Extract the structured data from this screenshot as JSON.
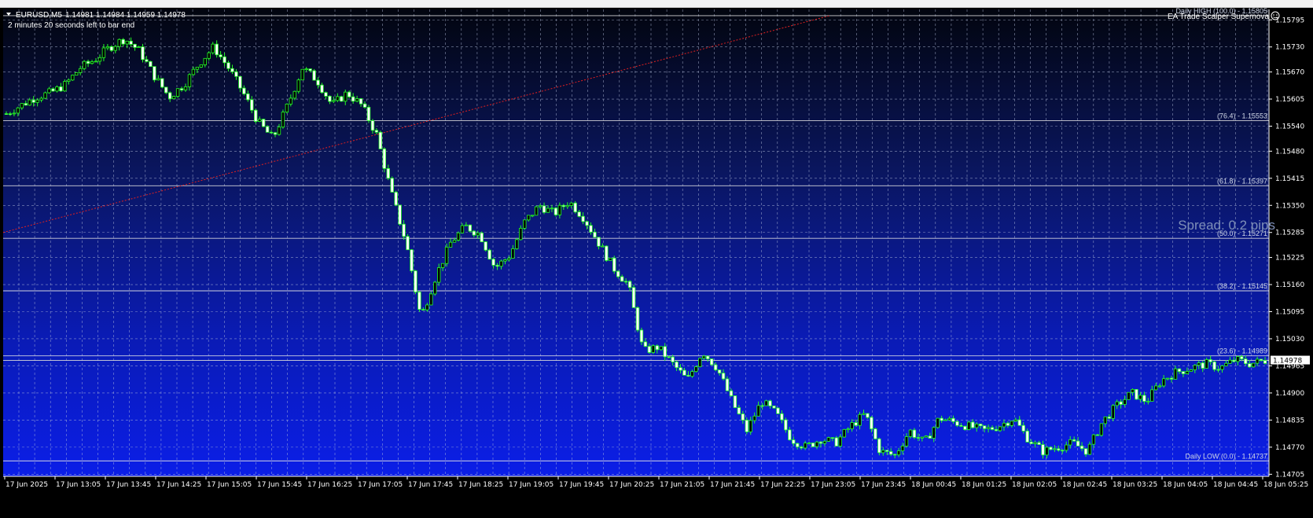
{
  "header": {
    "symbol": "EURUSD,M5",
    "ohlc": "1.14981 1.14984 1.14959 1.14978",
    "timer": "2 minutes 20 seconds left to bar end",
    "ea_name": "EA Trade Scalper Supernova"
  },
  "spread_text": "Spread: 0.2 pips",
  "colors": {
    "background_top": "#02050f",
    "background_bottom": "#0b1ee8",
    "candle": "#24ff24",
    "grid": "#b4bedc",
    "trendline": "#e02020",
    "fib_line": "#e6e6e6",
    "fib_text": "#cfd6e6",
    "price_tag_bg": "#ffffff",
    "price_tag_text": "#000000"
  },
  "fib_levels": [
    {
      "price": 1.15805,
      "label": "Daily HIGH (100.0) - 1.15805"
    },
    {
      "price": 1.15553,
      "label": "(76.4) - 1.15553"
    },
    {
      "price": 1.15397,
      "label": "(61.8) - 1.15397"
    },
    {
      "price": 1.15271,
      "label": "(50.0) - 1.15271"
    },
    {
      "price": 1.15145,
      "label": "(38.2) - 1.15145"
    },
    {
      "price": 1.14989,
      "label": "(23.6) - 1.14989"
    },
    {
      "price": 1.14737,
      "label": "Daily LOW (0.0) - 1.14737"
    }
  ],
  "current_price": "1.14978",
  "chart_data": {
    "type": "candlestick",
    "symbol": "EURUSD",
    "timeframe": "M5",
    "ylim": [
      1.147,
      1.1582
    ],
    "y_ticks": [
      "1.15795",
      "1.15730",
      "1.15670",
      "1.15605",
      "1.15540",
      "1.15480",
      "1.15415",
      "1.15350",
      "1.15285",
      "1.15225",
      "1.15160",
      "1.15095",
      "1.15030",
      "1.14965",
      "1.14900",
      "1.14835",
      "1.14770",
      "1.14705"
    ],
    "x_ticks": [
      "17 Jun 2025",
      "17 Jun 13:05",
      "17 Jun 13:45",
      "17 Jun 14:25",
      "17 Jun 15:05",
      "17 Jun 15:45",
      "17 Jun 16:25",
      "17 Jun 17:05",
      "17 Jun 17:45",
      "17 Jun 18:25",
      "17 Jun 19:05",
      "17 Jun 19:45",
      "17 Jun 20:25",
      "17 Jun 21:05",
      "17 Jun 21:45",
      "17 Jun 22:25",
      "17 Jun 23:05",
      "17 Jun 23:45",
      "18 Jun 00:45",
      "18 Jun 01:25",
      "18 Jun 02:05",
      "18 Jun 02:45",
      "18 Jun 03:25",
      "18 Jun 04:05",
      "18 Jun 04:45",
      "18 Jun 05:25"
    ],
    "close_path": [
      1.1557,
      1.1559,
      1.1561,
      1.1562,
      1.1564,
      1.1568,
      1.157,
      1.1573,
      1.1575,
      1.1572,
      1.1566,
      1.1561,
      1.1564,
      1.1569,
      1.1573,
      1.1568,
      1.1562,
      1.1555,
      1.1551,
      1.1559,
      1.1568,
      1.1565,
      1.1559,
      1.1562,
      1.1559,
      1.1552,
      1.1538,
      1.1526,
      1.1508,
      1.1518,
      1.1526,
      1.153,
      1.1528,
      1.152,
      1.1523,
      1.1531,
      1.1535,
      1.1533,
      1.1536,
      1.1532,
      1.1526,
      1.152,
      1.1516,
      1.15,
      1.1501,
      1.1497,
      1.1493,
      1.15,
      1.1496,
      1.1488,
      1.1481,
      1.1488,
      1.1485,
      1.1479,
      1.1477,
      1.1479,
      1.1478,
      1.1482,
      1.1485,
      1.1476,
      1.1475,
      1.1481,
      1.1478,
      1.1484,
      1.1483,
      1.1482,
      1.1481,
      1.1482,
      1.1484,
      1.1479,
      1.1476,
      1.1477,
      1.1478,
      1.1476,
      1.1483,
      1.1487,
      1.149,
      1.1488,
      1.1493,
      1.1495,
      1.1496,
      1.1497,
      1.1496,
      1.1498,
      1.1497,
      1.14978
    ],
    "trendline": {
      "from": [
        0,
        1.15285
      ],
      "to": [
        0.653,
        1.15805
      ]
    }
  }
}
